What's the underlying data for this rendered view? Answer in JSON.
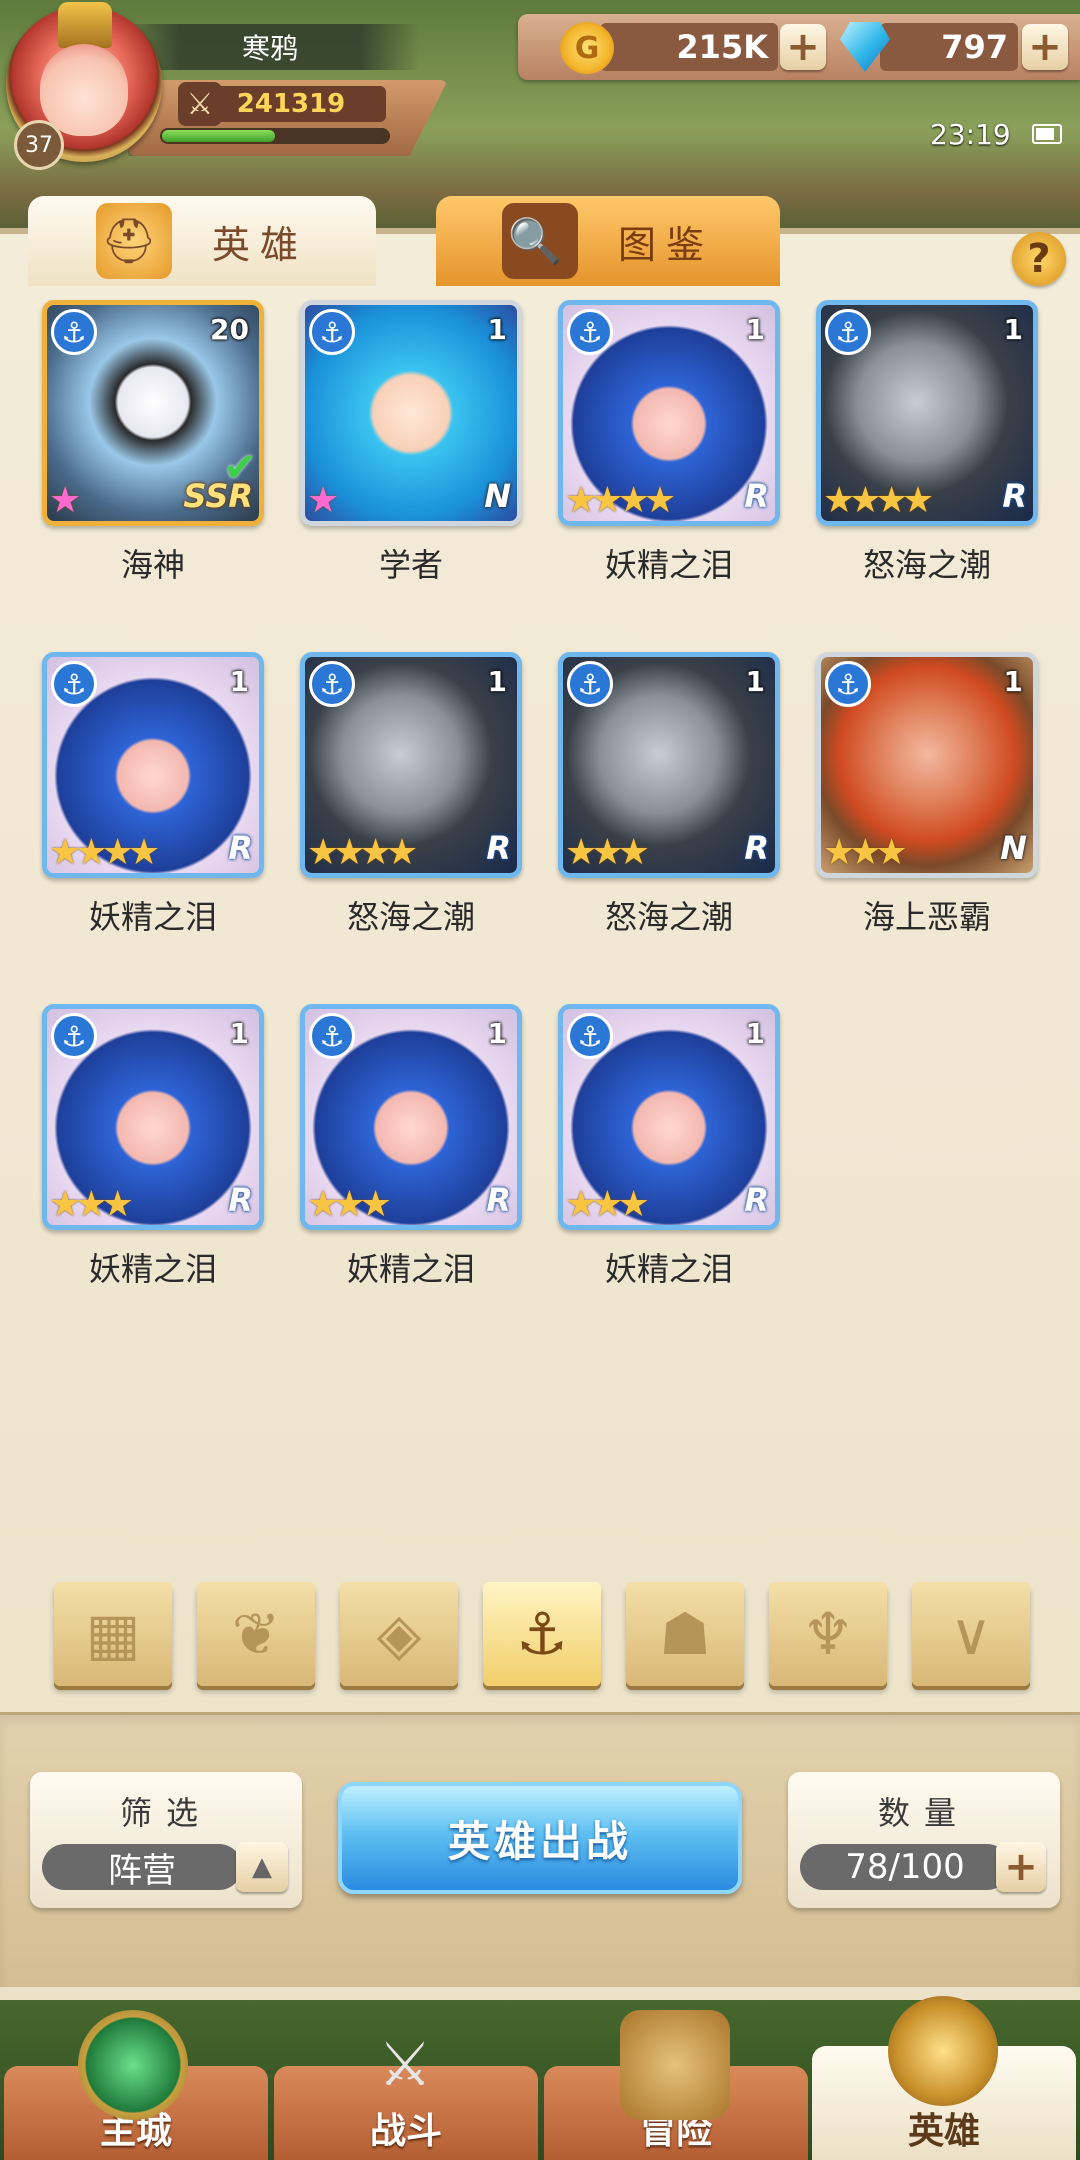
{
  "player": {
    "name": "寒鸦",
    "level": "37",
    "power": "241319",
    "xp_fraction": 0.5
  },
  "resources": {
    "gold": "215K",
    "gems": "797"
  },
  "status": {
    "time": "23:19"
  },
  "tabs": {
    "heroes": "英雄",
    "codex": "图鉴"
  },
  "heroes": [
    {
      "name": "海神",
      "count": "20",
      "stars": 1,
      "rarity": "SSR",
      "selected": true
    },
    {
      "name": "学者",
      "count": "1",
      "stars": 1,
      "rarity": "N"
    },
    {
      "name": "妖精之泪",
      "count": "1",
      "stars": 4,
      "rarity": "R"
    },
    {
      "name": "怒海之潮",
      "count": "1",
      "stars": 4,
      "rarity": "R"
    },
    {
      "name": "妖精之泪",
      "count": "1",
      "stars": 4,
      "rarity": "R"
    },
    {
      "name": "怒海之潮",
      "count": "1",
      "stars": 4,
      "rarity": "R"
    },
    {
      "name": "怒海之潮",
      "count": "1",
      "stars": 3,
      "rarity": "R"
    },
    {
      "name": "海上恶霸",
      "count": "1",
      "stars": 3,
      "rarity": "N"
    },
    {
      "name": "妖精之泪",
      "count": "1",
      "stars": 3,
      "rarity": "R"
    },
    {
      "name": "妖精之泪",
      "count": "1",
      "stars": 3,
      "rarity": "R"
    },
    {
      "name": "妖精之泪",
      "count": "1",
      "stars": 3,
      "rarity": "R"
    }
  ],
  "filter_tabs": [
    {
      "icon": "grid-icon",
      "active": false
    },
    {
      "icon": "leaf-icon",
      "active": false
    },
    {
      "icon": "diamond-icon",
      "active": false
    },
    {
      "icon": "anchor-icon",
      "active": true
    },
    {
      "icon": "beast-icon",
      "active": false
    },
    {
      "icon": "demon-icon",
      "active": false
    },
    {
      "icon": "wing-icon",
      "active": false
    }
  ],
  "controls": {
    "filter_label": "筛选",
    "filter_value": "阵营",
    "deploy_label": "英雄出战",
    "quantity_label": "数量",
    "quantity_value": "78/100"
  },
  "nav": {
    "city": "主城",
    "battle": "战斗",
    "adventure": "冒险",
    "heroes": "英雄"
  },
  "colors": {
    "card_r": "#6fb7ef",
    "card_ssr": "#f0b13a",
    "card_n": "#cfd6de",
    "deploy": "#2a8be0"
  }
}
